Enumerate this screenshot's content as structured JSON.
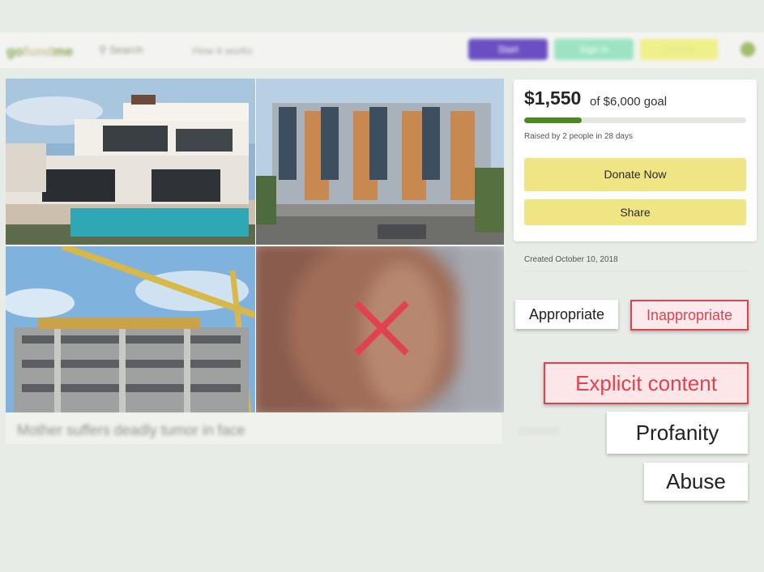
{
  "nav": {
    "logo_part1": "go",
    "logo_part2": "fund",
    "logo_part3": "me",
    "search_label": "Search",
    "link_label": "How it works",
    "btn_primary": "Start",
    "btn_secondary": "Sign in",
    "btn_tertiary": "Donate"
  },
  "campaign": {
    "headline": "Mother suffers deadly tumor in face",
    "amount": "$1,550",
    "goal_text": "of $6,000 goal",
    "progress_fraction": 0.26,
    "progress_color": "#4b8a1f",
    "raised_text": "Raised by 2 people in 28 days",
    "donate_label": "Donate Now",
    "share_label": "Share",
    "created_text": "Created October 10, 2018"
  },
  "gallery": {
    "tiles": [
      "modern-villa-photo",
      "townhouses-photo",
      "construction-site-photo",
      "blurred-skin-photo"
    ],
    "flag_icon": "red-x-icon",
    "flag_color": "#e0434f"
  },
  "moderation": {
    "appropriate": "Appropriate",
    "inappropriate": "Inappropriate",
    "explicit": "Explicit content",
    "profanity": "Profanity",
    "abuse": "Abuse",
    "highlight_color": "#e0434f"
  }
}
